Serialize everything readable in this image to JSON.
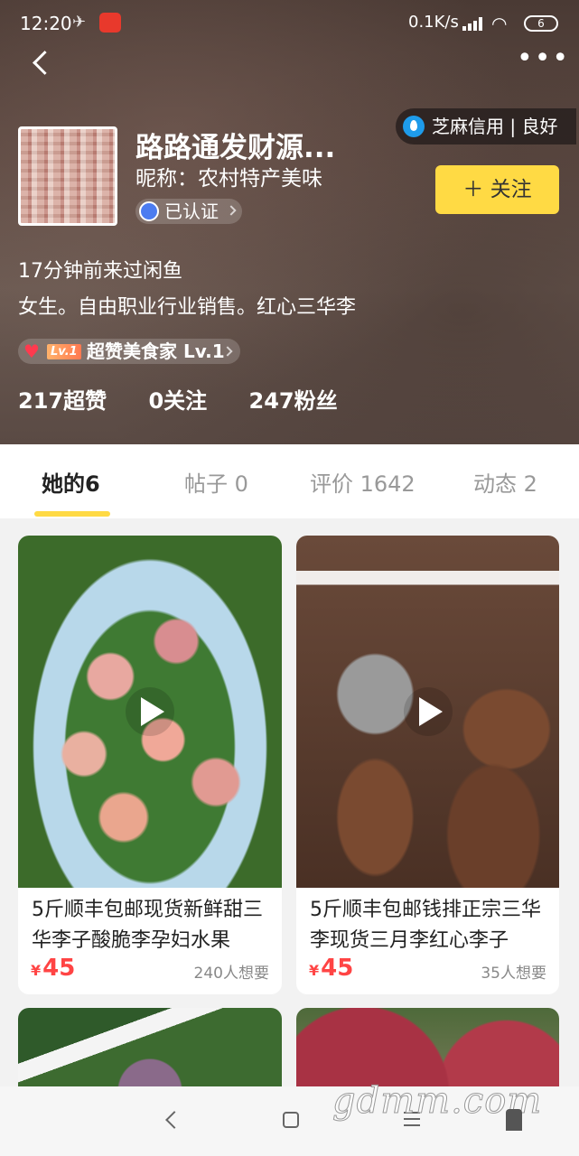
{
  "status_bar": {
    "time": "12:20",
    "speed": "0.1K/s",
    "battery": "6"
  },
  "profile": {
    "name": "路路通发财源...",
    "nickname": "昵称：农村特产美味",
    "verified": "已认证",
    "credit": "芝麻信用 | 良好",
    "follow_label": "＋ 关注",
    "last_seen": "17分钟前来过闲鱼",
    "bio": "女生。自由职业行业销售。红心三华李",
    "badge_level": "Lv.1",
    "badge_title": "超赞美食家 Lv.1",
    "stats": {
      "likes": "217超赞",
      "following": "0关注",
      "fans": "247粉丝"
    }
  },
  "tabs": [
    {
      "label": "她的6"
    },
    {
      "label": "帖子 0"
    },
    {
      "label": "评价 1642"
    },
    {
      "label": "动态 2"
    }
  ],
  "items": [
    {
      "title": "5斤顺丰包邮现货新鲜甜三华李子酸脆李孕妇水果",
      "currency": "¥",
      "price": "45",
      "wants": "240人想要",
      "image_icon": "plums-video"
    },
    {
      "title": "5斤顺丰包邮钱排正宗三华李现货三月李红心李子",
      "currency": "¥",
      "price": "45",
      "wants": "35人想要",
      "image_icon": "market-video"
    }
  ],
  "watermark": "gdmm.com"
}
